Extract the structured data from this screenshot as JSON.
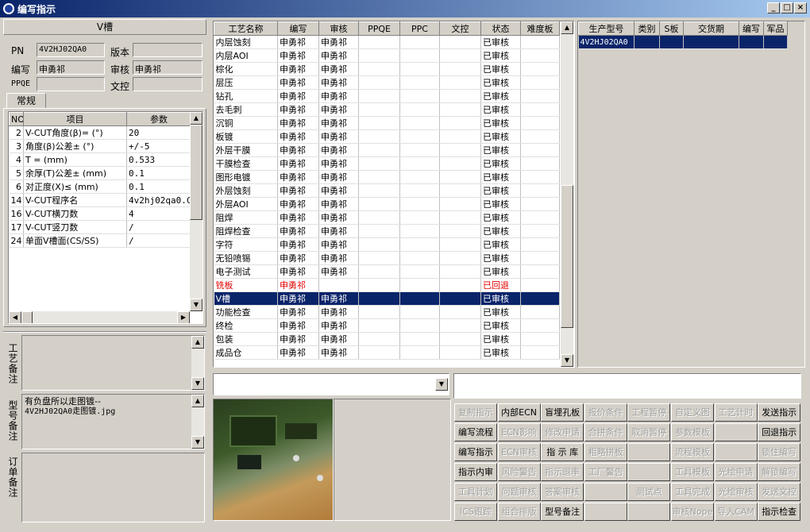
{
  "window": {
    "title": "编写指示",
    "min": "_",
    "max": "□",
    "close": "×"
  },
  "left": {
    "header": "V槽",
    "pn_label": "PN",
    "pn_value": "4V2HJ02QA0",
    "version_label": "版本",
    "version_value": "",
    "author_label": "编写",
    "author_value": "申勇祁",
    "review_label": "审核",
    "review_value": "申勇祁",
    "ppqe_label": "PPQE",
    "ppqe_value": "",
    "doccontrol_label": "文控",
    "doccontrol_value": "",
    "tab": "常规",
    "param_headers": {
      "no": "NO",
      "item": "项目",
      "param": "参数"
    },
    "params": [
      {
        "no": "2",
        "item": "V-CUT角度(β)=  (°)",
        "param": "20"
      },
      {
        "no": "3",
        "item": "角度(β)公差±  (°)",
        "param": "+/-5"
      },
      {
        "no": "4",
        "item": "T =  (mm)",
        "param": "0.533"
      },
      {
        "no": "5",
        "item": "余厚(T)公差±  (mm)",
        "param": "0.1"
      },
      {
        "no": "6",
        "item": "对正度(X)≤  (mm)",
        "param": "0.1"
      },
      {
        "no": "14",
        "item": "V-CUT程序名",
        "param": "4v2hj02qa0.CS"
      },
      {
        "no": "16",
        "item": "V-CUT横刀数",
        "param": "4"
      },
      {
        "no": "17",
        "item": "V-CUT竖刀数",
        "param": "/"
      },
      {
        "no": "24",
        "item": "单面V槽面(CS/SS)",
        "param": "/"
      }
    ],
    "process_note_label": "工艺备注",
    "process_note": "",
    "model_note_label": "型号备注",
    "model_note_lines": [
      "有负盘所以走图镀--",
      "4V2HJ02QA0走图镀.jpg"
    ],
    "order_note_label": "订单备注",
    "order_note": ""
  },
  "process": {
    "headers": [
      "工艺名称",
      "编写",
      "审核",
      "PPQE",
      "PPC",
      "文控",
      "状态",
      "难度板"
    ],
    "rows": [
      {
        "name": "内层蚀刻",
        "author": "申勇祁",
        "review": "申勇祁",
        "status": "已审核"
      },
      {
        "name": "内层AOI",
        "author": "申勇祁",
        "review": "申勇祁",
        "status": "已审核"
      },
      {
        "name": "棕化",
        "author": "申勇祁",
        "review": "申勇祁",
        "status": "已审核"
      },
      {
        "name": "层压",
        "author": "申勇祁",
        "review": "申勇祁",
        "status": "已审核"
      },
      {
        "name": "钻孔",
        "author": "申勇祁",
        "review": "申勇祁",
        "status": "已审核"
      },
      {
        "name": "去毛刺",
        "author": "申勇祁",
        "review": "申勇祁",
        "status": "已审核"
      },
      {
        "name": "沉铜",
        "author": "申勇祁",
        "review": "申勇祁",
        "status": "已审核"
      },
      {
        "name": "板镀",
        "author": "申勇祁",
        "review": "申勇祁",
        "status": "已审核"
      },
      {
        "name": "外层干膜",
        "author": "申勇祁",
        "review": "申勇祁",
        "status": "已审核"
      },
      {
        "name": "干膜检查",
        "author": "申勇祁",
        "review": "申勇祁",
        "status": "已审核"
      },
      {
        "name": "图形电镀",
        "author": "申勇祁",
        "review": "申勇祁",
        "status": "已审核"
      },
      {
        "name": "外层蚀刻",
        "author": "申勇祁",
        "review": "申勇祁",
        "status": "已审核"
      },
      {
        "name": "外层AOI",
        "author": "申勇祁",
        "review": "申勇祁",
        "status": "已审核"
      },
      {
        "name": "阻焊",
        "author": "申勇祁",
        "review": "申勇祁",
        "status": "已审核"
      },
      {
        "name": "阻焊检查",
        "author": "申勇祁",
        "review": "申勇祁",
        "status": "已审核"
      },
      {
        "name": "字符",
        "author": "申勇祁",
        "review": "申勇祁",
        "status": "已审核"
      },
      {
        "name": "无铅喷锡",
        "author": "申勇祁",
        "review": "申勇祁",
        "status": "已审核"
      },
      {
        "name": "电子测试",
        "author": "申勇祁",
        "review": "申勇祁",
        "status": "已审核"
      },
      {
        "name": "铣板",
        "author": "申勇祁",
        "review": "",
        "status": "已回退"
      },
      {
        "name": "V槽",
        "author": "申勇祁",
        "review": "申勇祁",
        "status": "已审核"
      },
      {
        "name": "功能检查",
        "author": "申勇祁",
        "review": "申勇祁",
        "status": "已审核"
      },
      {
        "name": "终检",
        "author": "申勇祁",
        "review": "申勇祁",
        "status": "已审核"
      },
      {
        "name": "包装",
        "author": "申勇祁",
        "review": "申勇祁",
        "status": "已审核"
      },
      {
        "name": "成品仓",
        "author": "申勇祁",
        "review": "申勇祁",
        "status": "已审核"
      }
    ]
  },
  "orders": {
    "headers": [
      "生产型号",
      "类别",
      "S板",
      "交货期",
      "编写",
      "军品"
    ],
    "rows": [
      {
        "model": "4V2HJ02QA0"
      }
    ]
  },
  "colors": {
    "selection": "#0a246a",
    "returned": "#e00000",
    "face": "#d4d0c8"
  },
  "buttons": [
    [
      "复制指示",
      "内部ECN",
      "盲埋孔板",
      "报价条件",
      "工程暂停",
      "自定义图",
      "工艺计时",
      "发送指示"
    ],
    [
      "编写流程",
      "ECN影响",
      "修改申请",
      "合拼条件",
      "取消暂停",
      "参数模板",
      "",
      "回退指示"
    ],
    [
      "编写指示",
      "ECN审核",
      "指 示 库",
      "粗略拼板",
      "",
      "流程模板",
      "",
      "锁住编写"
    ],
    [
      "指示内审",
      "风险警告",
      "指示退率",
      "工厂警告",
      "",
      "工具模板",
      "光绘申请",
      "解锁编写"
    ],
    [
      "工具计划",
      "问题审核",
      "答案审核",
      "",
      "测试点",
      "工具完成",
      "光绘审核",
      "发送文控"
    ],
    [
      "ICS跟踪",
      "组合排版",
      "型号备注",
      "",
      "",
      "审核Nope",
      "导入CAM",
      "指示检查"
    ]
  ],
  "button_enabled": [
    [
      false,
      true,
      true,
      false,
      false,
      false,
      false,
      true
    ],
    [
      true,
      false,
      false,
      false,
      false,
      false,
      false,
      true
    ],
    [
      true,
      false,
      true,
      false,
      false,
      false,
      false,
      false
    ],
    [
      true,
      false,
      false,
      false,
      false,
      false,
      false,
      false
    ],
    [
      false,
      false,
      false,
      false,
      false,
      false,
      false,
      false
    ],
    [
      false,
      false,
      true,
      false,
      false,
      false,
      false,
      true
    ]
  ]
}
